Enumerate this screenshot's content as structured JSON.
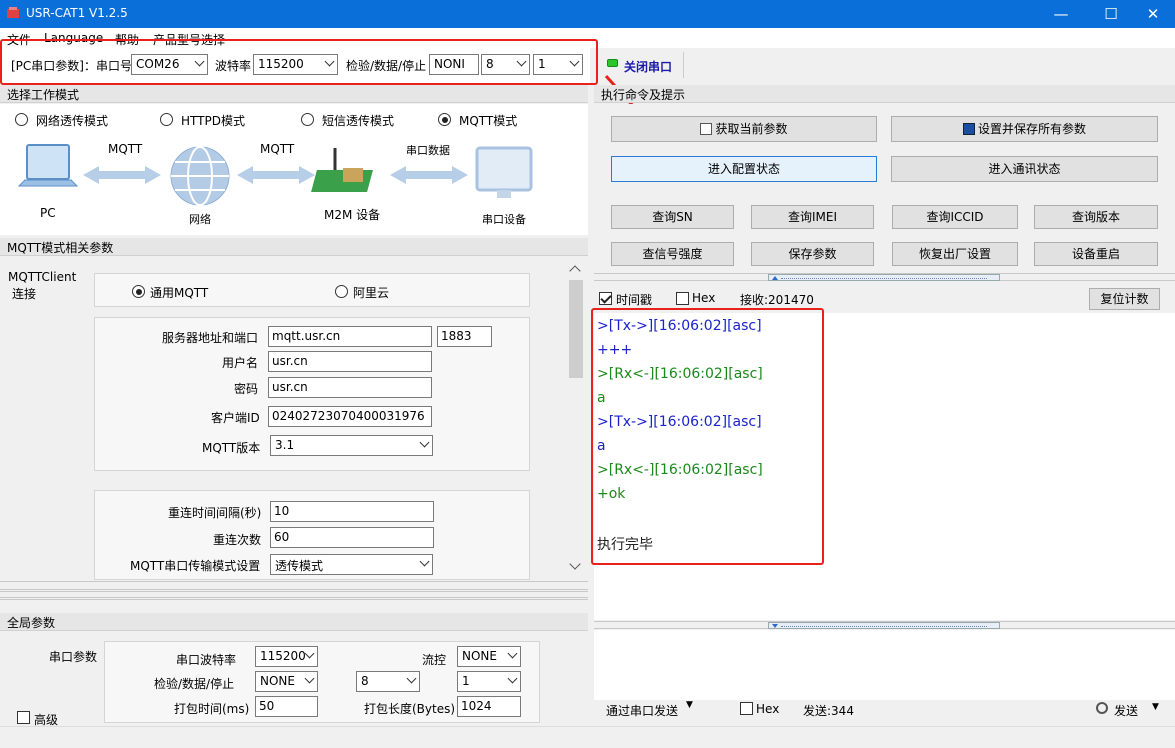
{
  "window": {
    "title": "USR-CAT1 V1.2.5"
  },
  "menu": {
    "items": [
      "文件",
      "Language",
      "帮助",
      "产品型号选择"
    ]
  },
  "serial": {
    "prefix": "[PC串口参数]：串口号",
    "port": "COM26",
    "baud_label": "波特率",
    "baud": "115200",
    "parity_label": "检验/数据/停止",
    "parity": "NONI",
    "databits": "8",
    "stopbits": "1",
    "close_button": "关闭串口"
  },
  "work_mode": {
    "heading": "选择工作模式",
    "options": [
      "网络透传模式",
      "HTTPD模式",
      "短信透传模式",
      "MQTT模式"
    ],
    "selected": "MQTT模式",
    "diagram": {
      "pc": "PC",
      "arrow1": "MQTT",
      "net": "网络",
      "arrow2": "MQTT",
      "m2m": "M2M 设备",
      "arrow3": "串口数据",
      "serial_dev": "串口设备"
    }
  },
  "mqtt": {
    "heading": "MQTT模式相关参数",
    "client_label": "MQTTClient\n连接",
    "client_line1": "MQTTClient",
    "client_line2": "连接",
    "type_options": [
      "通用MQTT",
      "阿里云"
    ],
    "type_selected": "通用MQTT",
    "server_label": "服务器地址和端口",
    "server": "mqtt.usr.cn",
    "port": "1883",
    "user_label": "用户名",
    "user": "usr.cn",
    "pwd_label": "密码",
    "pwd": "usr.cn",
    "client_id_label": "客户端ID",
    "client_id": "02402723070400031976",
    "version_label": "MQTT版本",
    "version": "3.1",
    "reconnect_interval_label": "重连时间间隔(秒)",
    "reconnect_interval": "10",
    "reconnect_count_label": "重连次数",
    "reconnect_count": "60",
    "serial_mode_label": "MQTT串口传输模式设置",
    "serial_mode": "透传模式"
  },
  "global": {
    "heading": "全局参数",
    "serial_label": "串口参数",
    "baud_label": "串口波特率",
    "baud": "115200",
    "flow_label": "流控",
    "flow": "NONE",
    "parity_label": "检验/数据/停止",
    "parity": "NONE",
    "databits": "8",
    "stopbits": "1",
    "pack_time_label": "打包时间(ms)",
    "pack_time": "50",
    "pack_len_label": "打包长度(Bytes)",
    "pack_len": "1024",
    "advanced_label": "高级"
  },
  "commands": {
    "heading": "执行命令及提示",
    "get_params": "获取当前参数",
    "save_all": "设置并保存所有参数",
    "enter_config": "进入配置状态",
    "enter_comm": "进入通讯状态",
    "row1": [
      "查询SN",
      "查询IMEI",
      "查询ICCID",
      "查询版本"
    ],
    "row2": [
      "查信号强度",
      "保存参数",
      "恢复出厂设置",
      "设备重启"
    ]
  },
  "log": {
    "timestamp_label": "时间戳",
    "timestamp_checked": true,
    "hex_label": "Hex",
    "hex_checked": false,
    "recv_label": "接收:201470",
    "reset_button": "复位计数",
    "lines": [
      {
        "text": ">[Tx->][16:06:02][asc]",
        "kind": "tx"
      },
      {
        "text": "+++",
        "kind": "tx"
      },
      {
        "text": ">[Rx<-][16:06:02][asc]",
        "kind": "rx"
      },
      {
        "text": "a",
        "kind": "rx"
      },
      {
        "text": ">[Tx->][16:06:02][asc]",
        "kind": "tx"
      },
      {
        "text": "a",
        "kind": "tx"
      },
      {
        "text": ">[Rx<-][16:06:02][asc]",
        "kind": "rx"
      },
      {
        "text": "+ok",
        "kind": "rx"
      },
      {
        "text": "",
        "kind": "blk"
      },
      {
        "text": "执行完毕",
        "kind": "blk"
      }
    ]
  },
  "send": {
    "via_label": "通过串口发送",
    "hex_label": "Hex",
    "sent_label": "发送:344",
    "send_button": "发送"
  },
  "colors": {
    "accent": "#0a6fd8",
    "highlight": "#e8221a",
    "tx": "#1a22cc",
    "rx": "#1a8a1a"
  }
}
